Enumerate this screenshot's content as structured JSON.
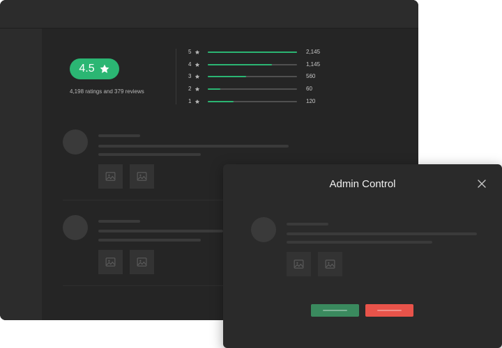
{
  "rating": {
    "score": "4.5",
    "summary": "4,198 ratings and 379 reviews",
    "accent_color": "#2bb673",
    "distribution": [
      {
        "stars": "5",
        "count": "2,145",
        "fill": 1.0
      },
      {
        "stars": "4",
        "count": "1,145",
        "fill": 0.72
      },
      {
        "stars": "3",
        "count": "560",
        "fill": 0.43
      },
      {
        "stars": "2",
        "count": "60",
        "fill": 0.14
      },
      {
        "stars": "1",
        "count": "120",
        "fill": 0.29
      }
    ]
  },
  "icons": {
    "star": "star-icon",
    "image": "image-icon",
    "close": "close-icon"
  },
  "modal": {
    "title": "Admin Control",
    "approve_color": "#3a8a5e",
    "reject_color": "#e8534a"
  }
}
